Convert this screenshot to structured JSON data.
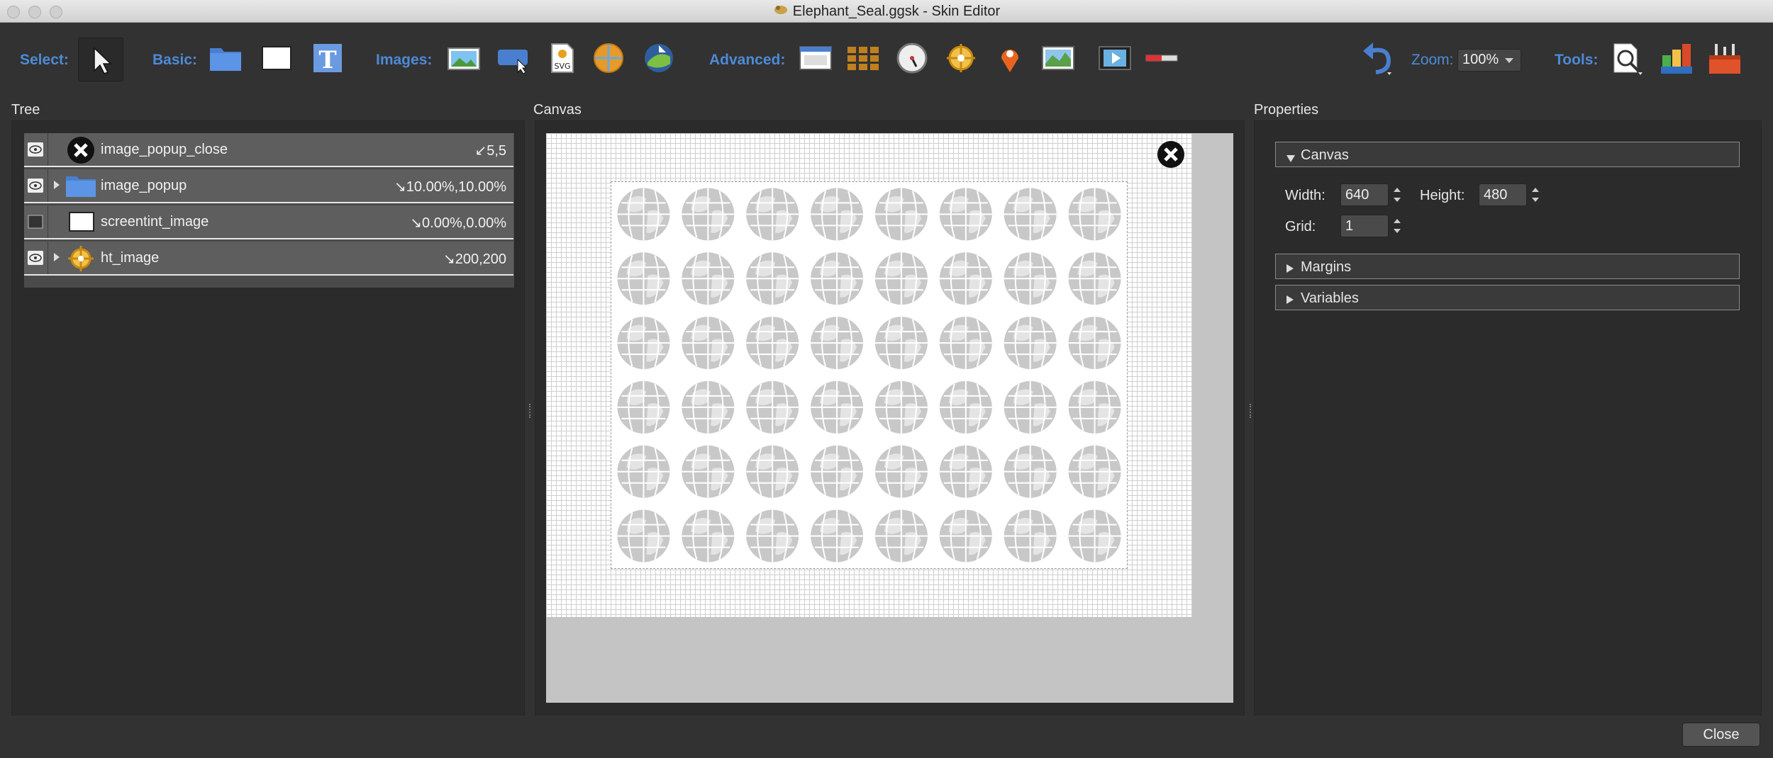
{
  "window": {
    "title": "Elephant_Seal.ggsk - Skin Editor"
  },
  "toolbar": {
    "select_label": "Select:",
    "basic_label": "Basic:",
    "images_label": "Images:",
    "advanced_label": "Advanced:",
    "zoom_label": "Zoom:",
    "zoom_value": "100%",
    "tools_label": "Tools:"
  },
  "panels": {
    "tree": "Tree",
    "canvas": "Canvas",
    "properties": "Properties"
  },
  "tree": {
    "items": [
      {
        "name": "image_popup_close",
        "coord": "↙5,5",
        "visible": true,
        "expandable": false,
        "icon": "close-icon"
      },
      {
        "name": "image_popup",
        "coord": "↘10.00%,10.00%",
        "visible": true,
        "expandable": true,
        "icon": "folder-icon"
      },
      {
        "name": "screentint_image",
        "coord": "↘0.00%,0.00%",
        "visible": false,
        "expandable": false,
        "icon": "rectangle-icon"
      },
      {
        "name": "ht_image",
        "coord": "↘200,200",
        "visible": true,
        "expandable": true,
        "icon": "hotspot-icon"
      }
    ]
  },
  "properties": {
    "canvas_section": "Canvas",
    "width_label": "Width:",
    "width_value": "640",
    "height_label": "Height:",
    "height_value": "480",
    "grid_label": "Grid:",
    "grid_value": "1",
    "margins_section": "Margins",
    "variables_section": "Variables"
  },
  "footer": {
    "close_label": "Close"
  },
  "colors": {
    "accent": "#4d8ad6",
    "background": "#323232"
  }
}
